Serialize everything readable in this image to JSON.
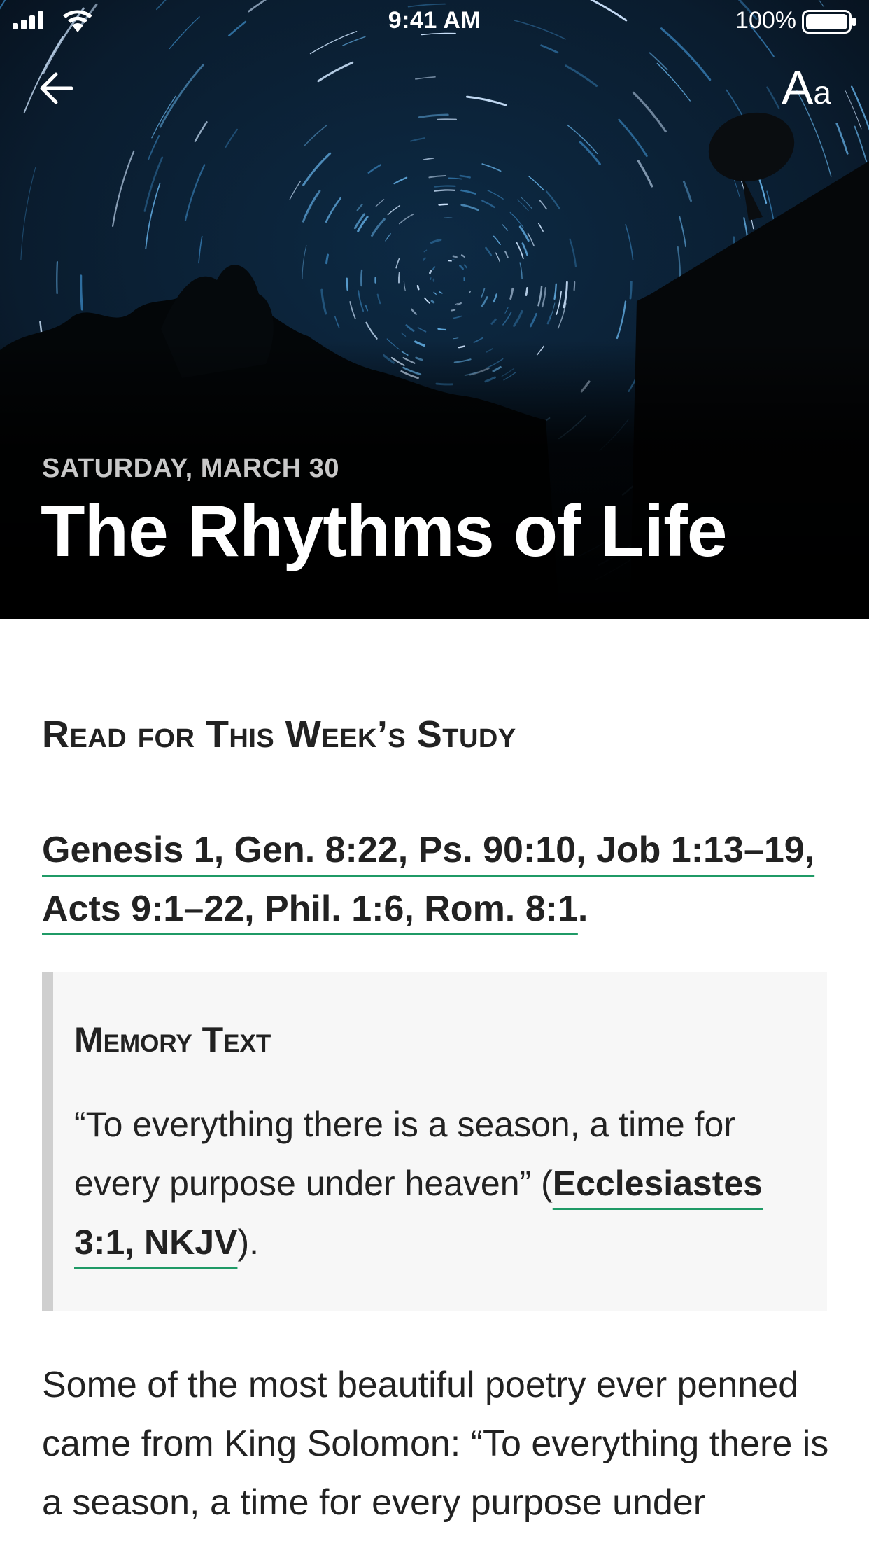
{
  "status_bar": {
    "time": "9:41 AM",
    "battery": "100%"
  },
  "header": {
    "back_icon": "arrow-left-icon",
    "font_size_icon": "Aa",
    "font_size_big": "A",
    "font_size_small": "a"
  },
  "hero": {
    "date": "SATURDAY, MARCH 30",
    "title": "The Rhythms of Life"
  },
  "study": {
    "heading": "Read for This Week’s Study",
    "references_link": "Genesis 1, Gen. 8:22, Ps. 90:10, Job 1:13–19, Acts 9:1–22, Phil. 1:6, Rom. 8:1",
    "references_end": "."
  },
  "memory": {
    "title": "Memory Text",
    "quote": "“To everything there is a season, a time for every purpose under heaven” (",
    "reference": "Ecclesiastes 3:1, NKJV",
    "quote_end": ")."
  },
  "body": {
    "paragraph": "Some of the most beautiful poetry ever penned came from King Solomon: “To everything there is a season, a time for every purpose under heaven: a time to be born,"
  },
  "colors": {
    "link_underline": "#1f9a66",
    "hero_background": "#000000",
    "memory_bar": "#cfcfcf"
  }
}
